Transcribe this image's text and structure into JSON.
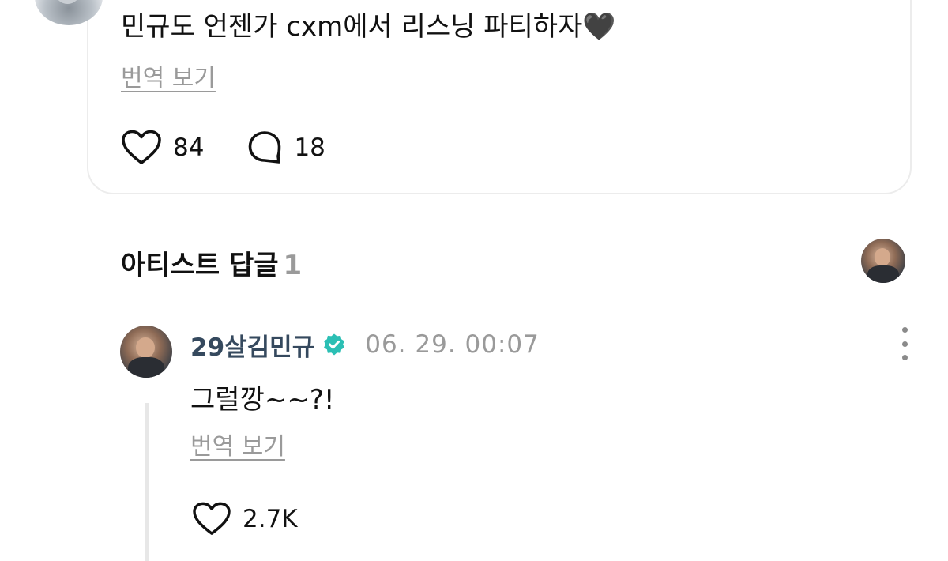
{
  "post": {
    "text": "민규도 언젠가 cxm에서 리스닝 파티하자",
    "emoji": "🖤",
    "translate_label": "번역 보기",
    "like_count": "84",
    "comment_count": "18"
  },
  "artist_replies": {
    "title": "아티스트 답글",
    "count": "1"
  },
  "reply": {
    "author": "29살김민규",
    "timestamp": "06. 29. 00:07",
    "text": "그럴깡~~?!",
    "translate_label": "번역 보기",
    "like_count": "2.7K"
  },
  "icons": {
    "like": "heart-icon",
    "comment": "comment-bubble-icon",
    "verified": "verified-badge-icon",
    "more": "more-vertical-icon"
  },
  "colors": {
    "author_name": "#35495e",
    "verified_badge": "#2bbfb4",
    "muted_text": "#9a9a9a"
  }
}
